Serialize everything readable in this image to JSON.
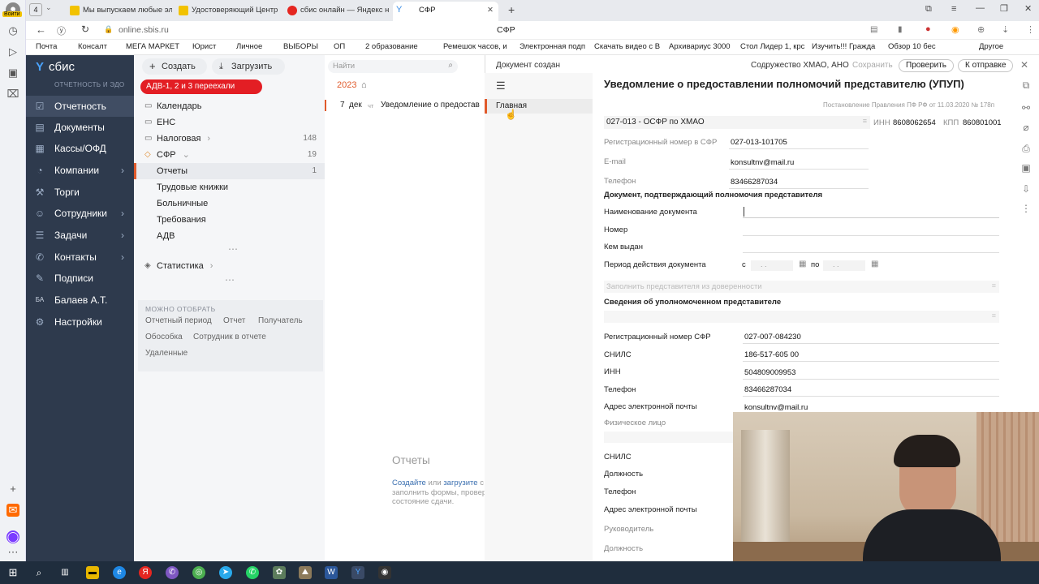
{
  "browser": {
    "profile_label": "Войти",
    "tab_count": "4",
    "tabs": [
      {
        "title": "Мы выпускаем любые эл",
        "color": "#f2c200"
      },
      {
        "title": "Удостоверяющий Центр",
        "color": "#f2c200"
      },
      {
        "title": "сбис онлайн — Яндекс н",
        "color": "#e52620"
      },
      {
        "title": "СФР",
        "color": "#3a8ee6"
      }
    ],
    "address": "online.sbis.ru",
    "page_title": "СФР",
    "bookmarks": [
      "Почта",
      "Консалт",
      "МЕГА МАРКЕТ",
      "Юрист",
      "Личное",
      "ВЫБОРЫ",
      "ОП",
      "2 образование",
      "Ремешок часов, и",
      "Электронная подп",
      "Скачать видео с В",
      "Архивариус 3000",
      "Стол Лидер 1, крс",
      "Изучить!!! Гражда",
      "Обзор 10 бес"
    ],
    "other_bookmarks": "Другое"
  },
  "sbis_nav": {
    "logo": "сбис",
    "subtitle": "ОТЧЕТНОСТЬ И ЭДО",
    "items": [
      {
        "label": "Отчетность",
        "icon": "report-icon"
      },
      {
        "label": "Документы",
        "icon": "document-icon"
      },
      {
        "label": "Кассы/ОФД",
        "icon": "cash-register-icon"
      },
      {
        "label": "Компании",
        "icon": "company-icon"
      },
      {
        "label": "Торги",
        "icon": "auction-icon"
      },
      {
        "label": "Сотрудники",
        "icon": "employees-icon"
      },
      {
        "label": "Задачи",
        "icon": "tasks-icon"
      },
      {
        "label": "Контакты",
        "icon": "contacts-icon"
      },
      {
        "label": "Подписи",
        "icon": "signature-icon"
      },
      {
        "label": "Балаев А.Т.",
        "icon": "user-avatar"
      },
      {
        "label": "Настройки",
        "icon": "settings-icon"
      }
    ],
    "avatar_initials": "БА"
  },
  "middle": {
    "create_label": "Создать",
    "upload_label": "Загрузить",
    "search_placeholder": "Найти",
    "banner": "АДВ-1, 2 и 3 переехали",
    "year": "2023",
    "items": [
      {
        "label": "Календарь",
        "count": ""
      },
      {
        "label": "ЕНС",
        "count": ""
      },
      {
        "label": "Налоговая",
        "count": "148"
      },
      {
        "label": "СФР",
        "count": "19"
      },
      {
        "label": "Отчеты",
        "count": "1"
      },
      {
        "label": "Трудовые книжки",
        "count": ""
      },
      {
        "label": "Больничные",
        "count": ""
      },
      {
        "label": "Требования",
        "count": ""
      },
      {
        "label": "АДВ",
        "count": ""
      },
      {
        "label": "Статистика",
        "count": ""
      }
    ],
    "filter_title": "МОЖНО ОТОБРАТЬ",
    "filters": [
      "Отчетный период",
      "Отчет",
      "Получатель",
      "Обособка",
      "Сотрудник в отчете",
      "Удаленные"
    ]
  },
  "list": {
    "row_day": "7",
    "row_month": "дек",
    "row_weekday": "чт",
    "row_title": "Уведомление о предостав",
    "empty_title": "Отчеты",
    "empty_link1": "Создайте",
    "empty_or": "или",
    "empty_link2": "загрузите",
    "empty_rest": "с к",
    "empty_line2": "заполнить формы, провер",
    "empty_line3": "состояние сдачи."
  },
  "doc": {
    "status": "Документ создан",
    "org": "Содружество ХМАО, АНО",
    "save": "Сохранить",
    "check": "Проверить",
    "send": "К отправке",
    "left_tab": "Главная",
    "title": "Уведомление о предоставлении полномочий представителю (УПУП)",
    "resolution": "Постановление Правления ПФ РФ от 11.03.2020 № 178п",
    "office": "027-013 - ОСФР по ХМАО",
    "inn_label": "ИНН",
    "inn": "8608062654",
    "kpp_label": "КПП",
    "kpp": "860801001",
    "reg_label": "Регистрационный номер в СФР",
    "reg": "027-013-101705",
    "email_label": "E-mail",
    "email": "konsultnv@mail.ru",
    "phone_label": "Телефон",
    "phone": "83466287034",
    "section1": "Документ, подтверждающий полномочия представителя",
    "doc_name_label": "Наименование документа",
    "number_label": "Номер",
    "issued_label": "Кем выдан",
    "period_label": "Период действия документа",
    "from": "с",
    "to": "по",
    "date_mask": ".   .",
    "fill_from_power": "Заполнить представителя из доверенности",
    "section2": "Сведения об уполномоченном представителе",
    "rep_reg_label": "Регистрационный номер СФР",
    "rep_reg": "027-007-084230",
    "snils_label": "СНИЛС",
    "snils": "186-517-605 00",
    "inn2_label": "ИНН",
    "inn2": "504809009953",
    "phone2_label": "Телефон",
    "phone2": "83466287034",
    "email2_label": "Адрес электронной почты",
    "email2": "konsultnv@mail.ru",
    "person_label": "Физическое лицо",
    "p_snils_label": "СНИЛС",
    "p_position_label": "Должность",
    "p_phone_label": "Телефон",
    "p_email_label": "Адрес электронной почты",
    "head_label": "Руководитель",
    "head_position_label": "Должность"
  }
}
